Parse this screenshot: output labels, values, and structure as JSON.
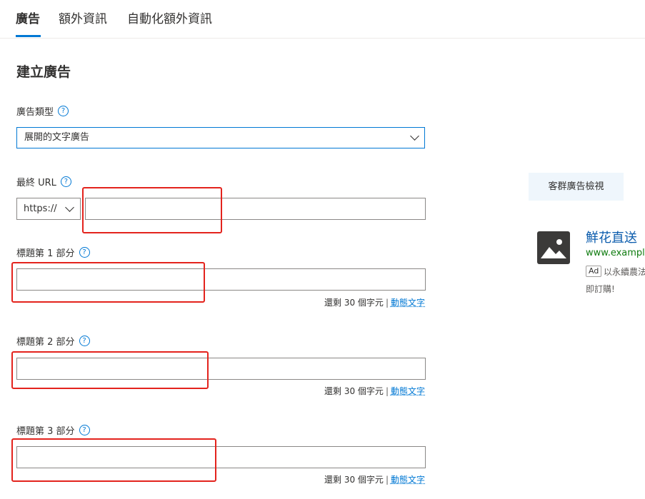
{
  "tabs": [
    {
      "label": "廣告",
      "active": true
    },
    {
      "label": "額外資訊",
      "active": false
    },
    {
      "label": "自動化額外資訊",
      "active": false
    }
  ],
  "page_title": "建立廣告",
  "ad_type": {
    "label": "廣告類型",
    "value": "展開的文字廣告"
  },
  "final_url": {
    "label": "最終 URL",
    "protocol": "https://",
    "value": ""
  },
  "headlines": [
    {
      "label": "標題第 1 部分",
      "value": "",
      "remaining": "還剩 30 個字元",
      "separator": "|",
      "link": "動態文字"
    },
    {
      "label": "標題第 2 部分",
      "value": "",
      "remaining": "還剩 30 個字元",
      "separator": "|",
      "link": "動態文字"
    },
    {
      "label": "標題第 3 部分",
      "value": "",
      "remaining": "還剩 30 個字元",
      "separator": "|",
      "link": "動態文字"
    }
  ],
  "help_glyph": "?",
  "preview": {
    "button_label": "客群廣告檢視",
    "ad_title": "鮮花直送",
    "ad_url": "www.example.",
    "ad_badge": "Ad",
    "ad_desc_line1": "以永續農法",
    "ad_desc_line2": "即訂購!"
  },
  "icons": {
    "help": "question-circle-icon",
    "dropdown": "chevron-down-icon",
    "image": "image-placeholder-icon"
  },
  "colors": {
    "accent": "#0078d4",
    "highlight": "#e3231d",
    "ad_title": "#0b5cad",
    "ad_url": "#107c10"
  }
}
